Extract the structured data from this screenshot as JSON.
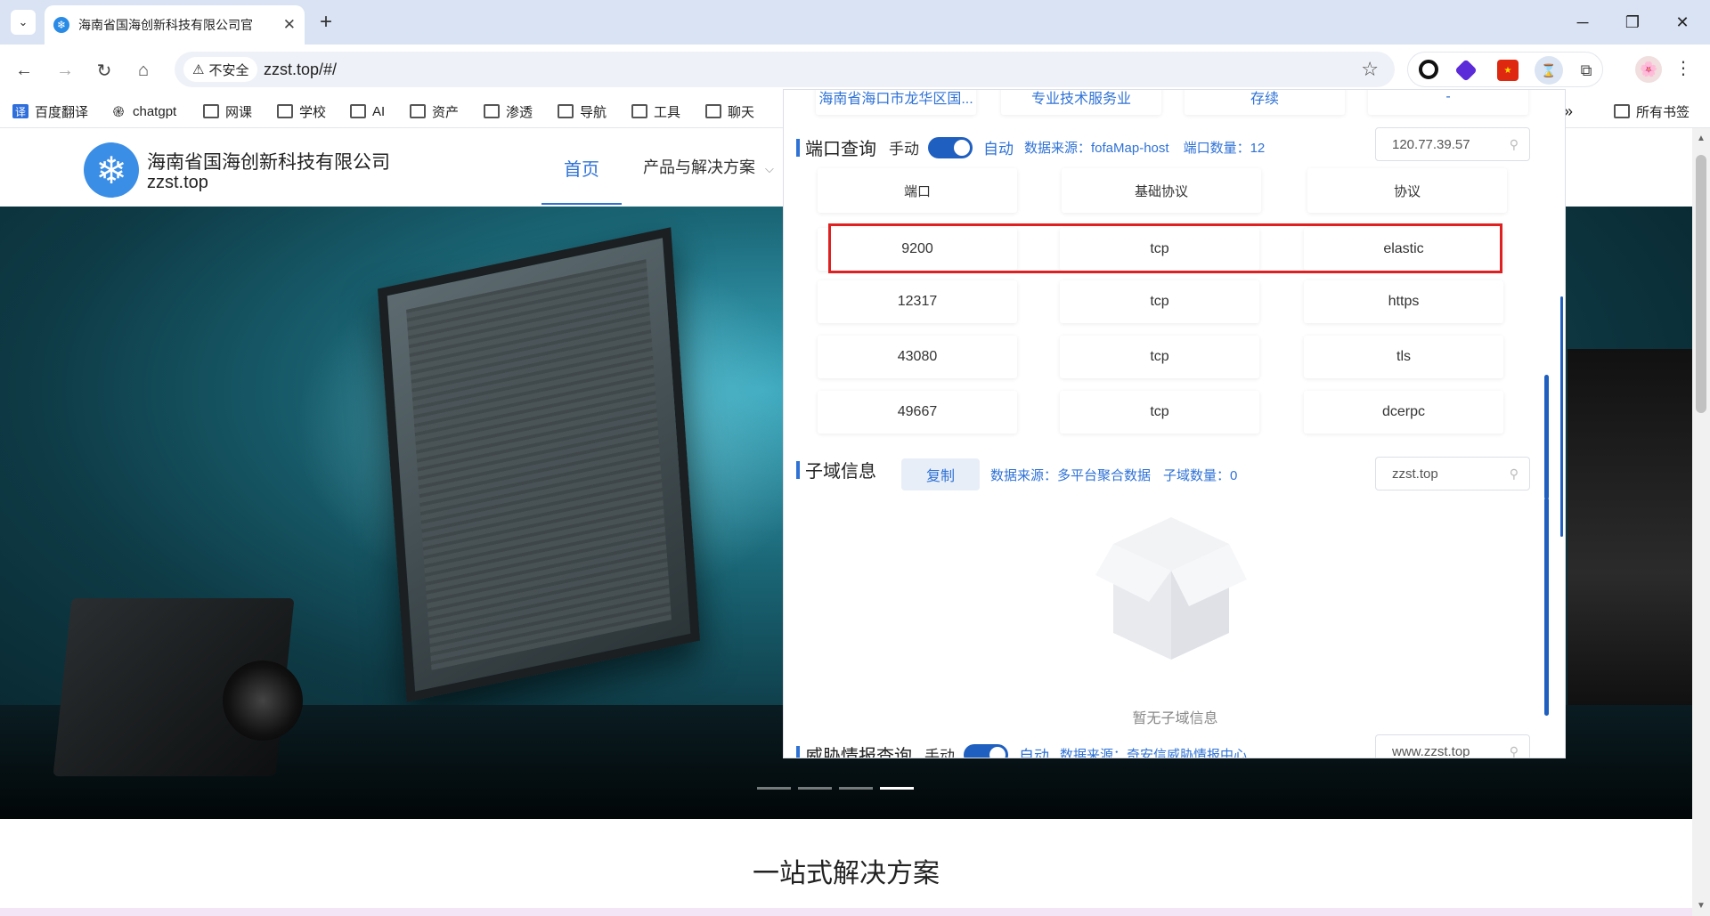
{
  "browser": {
    "tab_title": "海南省国海创新科技有限公司官",
    "address": "zzst.top/#/",
    "security": "不安全",
    "window_controls": [
      "─",
      "❐",
      "✕"
    ]
  },
  "bookmarks": [
    "百度翻译",
    "chatgpt",
    "网课",
    "学校",
    "AI",
    "资产",
    "渗透",
    "导航",
    "工具",
    "聊天"
  ],
  "bookmarks_more": "»",
  "bookmarks_all": "所有书签",
  "site": {
    "company_name": "海南省国海创新科技有限公司",
    "company_domain": "zzst.top",
    "nav": {
      "home": "首页",
      "products": "产品与解决方案"
    },
    "section_title": "一站式解决方案"
  },
  "panel": {
    "info_row": [
      "海南省海口市龙华区国...",
      "专业技术服务业",
      "存续",
      "-"
    ],
    "ports": {
      "title": "端口查询",
      "manual": "手动",
      "auto": "自动",
      "source": "数据来源：fofaMap-host",
      "count": "端口数量：12",
      "search_value": "120.77.39.57",
      "headers": [
        "端口",
        "基础协议",
        "协议"
      ],
      "rows": [
        [
          "9200",
          "tcp",
          "elastic"
        ],
        [
          "12317",
          "tcp",
          "https"
        ],
        [
          "43080",
          "tcp",
          "tls"
        ],
        [
          "49667",
          "tcp",
          "dcerpc"
        ]
      ]
    },
    "subdomains": {
      "title": "子域信息",
      "copy": "复制",
      "source": "数据来源：多平台聚合数据",
      "count": "子域数量：0",
      "search_value": "zzst.top",
      "empty": "暂无子域信息"
    },
    "threat": {
      "title": "威胁情报查询",
      "manual": "手动",
      "auto": "自动",
      "source": "数据来源：奇安信威胁情报中心",
      "search_value": "www.zzst.top"
    }
  },
  "colors": {
    "accent": "#2f72d6",
    "highlight": "#e02020",
    "toggle": "#1f5fbf"
  }
}
